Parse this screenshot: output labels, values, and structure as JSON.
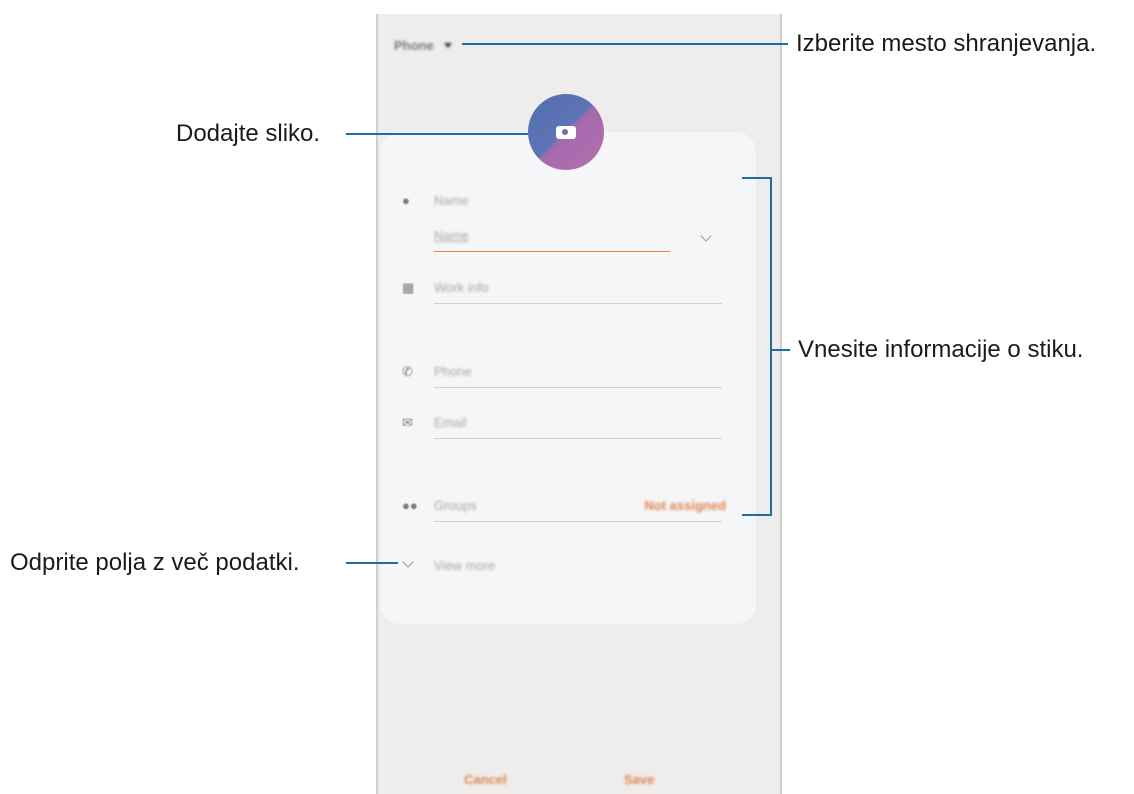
{
  "header": {
    "storage_label": "Phone"
  },
  "form": {
    "name_label": "Name",
    "name_field": "Name",
    "work_info": "Work info",
    "phone": "Phone",
    "email": "Email",
    "groups_label": "Groups",
    "groups_value": "Not assigned",
    "view_more": "View more"
  },
  "footer": {
    "cancel": "Cancel",
    "save": "Save"
  },
  "callouts": {
    "storage": "Izberite mesto shranjevanja.",
    "photo": "Dodajte sliko.",
    "info": "Vnesite informacije o stiku.",
    "more": "Odprite polja z več podatki."
  },
  "colors": {
    "accent": "#e2844f",
    "callout_line": "#1f6ea3"
  },
  "icons": [
    "dropdown-arrow-icon",
    "camera-icon",
    "person-icon",
    "building-icon",
    "phone-icon",
    "email-icon",
    "groups-icon",
    "chevron-down-icon"
  ]
}
